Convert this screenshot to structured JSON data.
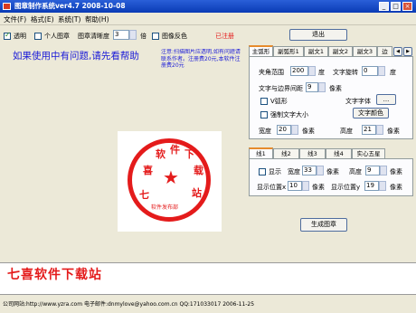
{
  "window": {
    "title": "图章制作系统ver4.7 2008-10-08",
    "min_symbol": "_",
    "max_symbol": "□",
    "close_symbol": "×"
  },
  "menu": [
    "文件(F)",
    "格式(E)",
    "系统(T)",
    "帮助(H)"
  ],
  "toolbar": {
    "transparent_label": "透明",
    "transparent_checked": true,
    "personal_label": "个人图章",
    "personal_checked": false,
    "clarity_label": "图章清晰度",
    "clarity_value": "3",
    "clarity_unit": "倍",
    "invert_label": "图像反色",
    "invert_checked": false,
    "registered": "已注册",
    "exit_label": "退出"
  },
  "help_text": "如果使用中有问题,请先看帮助",
  "notice_text": "注意:扫描图片应透明,如有问题请联系作者。注册费20元,本软件注册费20元",
  "seal": {
    "main_chars": [
      "七",
      "喜",
      "软",
      "件",
      "下",
      "载",
      "站"
    ],
    "center_symbol": "★",
    "bottom_text": "软件发布部"
  },
  "tabs_top": [
    "主弧形",
    "副弧形1",
    "副文1",
    "副文2",
    "副文3",
    "边"
  ],
  "tab_nav": [
    "◀",
    "▶"
  ],
  "arc_panel": {
    "angle_label": "夹角范围",
    "angle_value": "200",
    "angle_unit": "度",
    "rotate_label": "文字旋转",
    "rotate_value": "0",
    "rotate_unit": "度",
    "margin_label": "文字与边界间距",
    "margin_value": "9",
    "margin_unit": "像素",
    "vshape_label": "V弧形",
    "font_label": "文字字体",
    "font_button": "...",
    "force_size_label": "强制文字大小",
    "color_button": "文字颜色",
    "width_label": "宽度",
    "width_value": "20",
    "width_unit": "像素",
    "height_label": "高度",
    "height_value": "21",
    "height_unit": "像素"
  },
  "tabs_mid": [
    "线1",
    "线2",
    "线3",
    "线4",
    "实心五星"
  ],
  "line_panel": {
    "show_label": "显示",
    "width_label": "宽度",
    "width_value": "33",
    "width_unit": "像素",
    "height_label": "高度",
    "height_value": "9",
    "height_unit": "像素",
    "posx_label": "显示位置x",
    "posx_value": "10",
    "posx_unit": "像素",
    "posy_label": "显示位置y",
    "posy_value": "19",
    "posy_unit": "像素"
  },
  "generate_button": "生成图章",
  "preview_text": "七喜软件下载站",
  "status": "公司网站:http://www.yzra.com  电子邮件:dnmylove@yahoo.com.cn  QQ:171033017  2006-11-25"
}
